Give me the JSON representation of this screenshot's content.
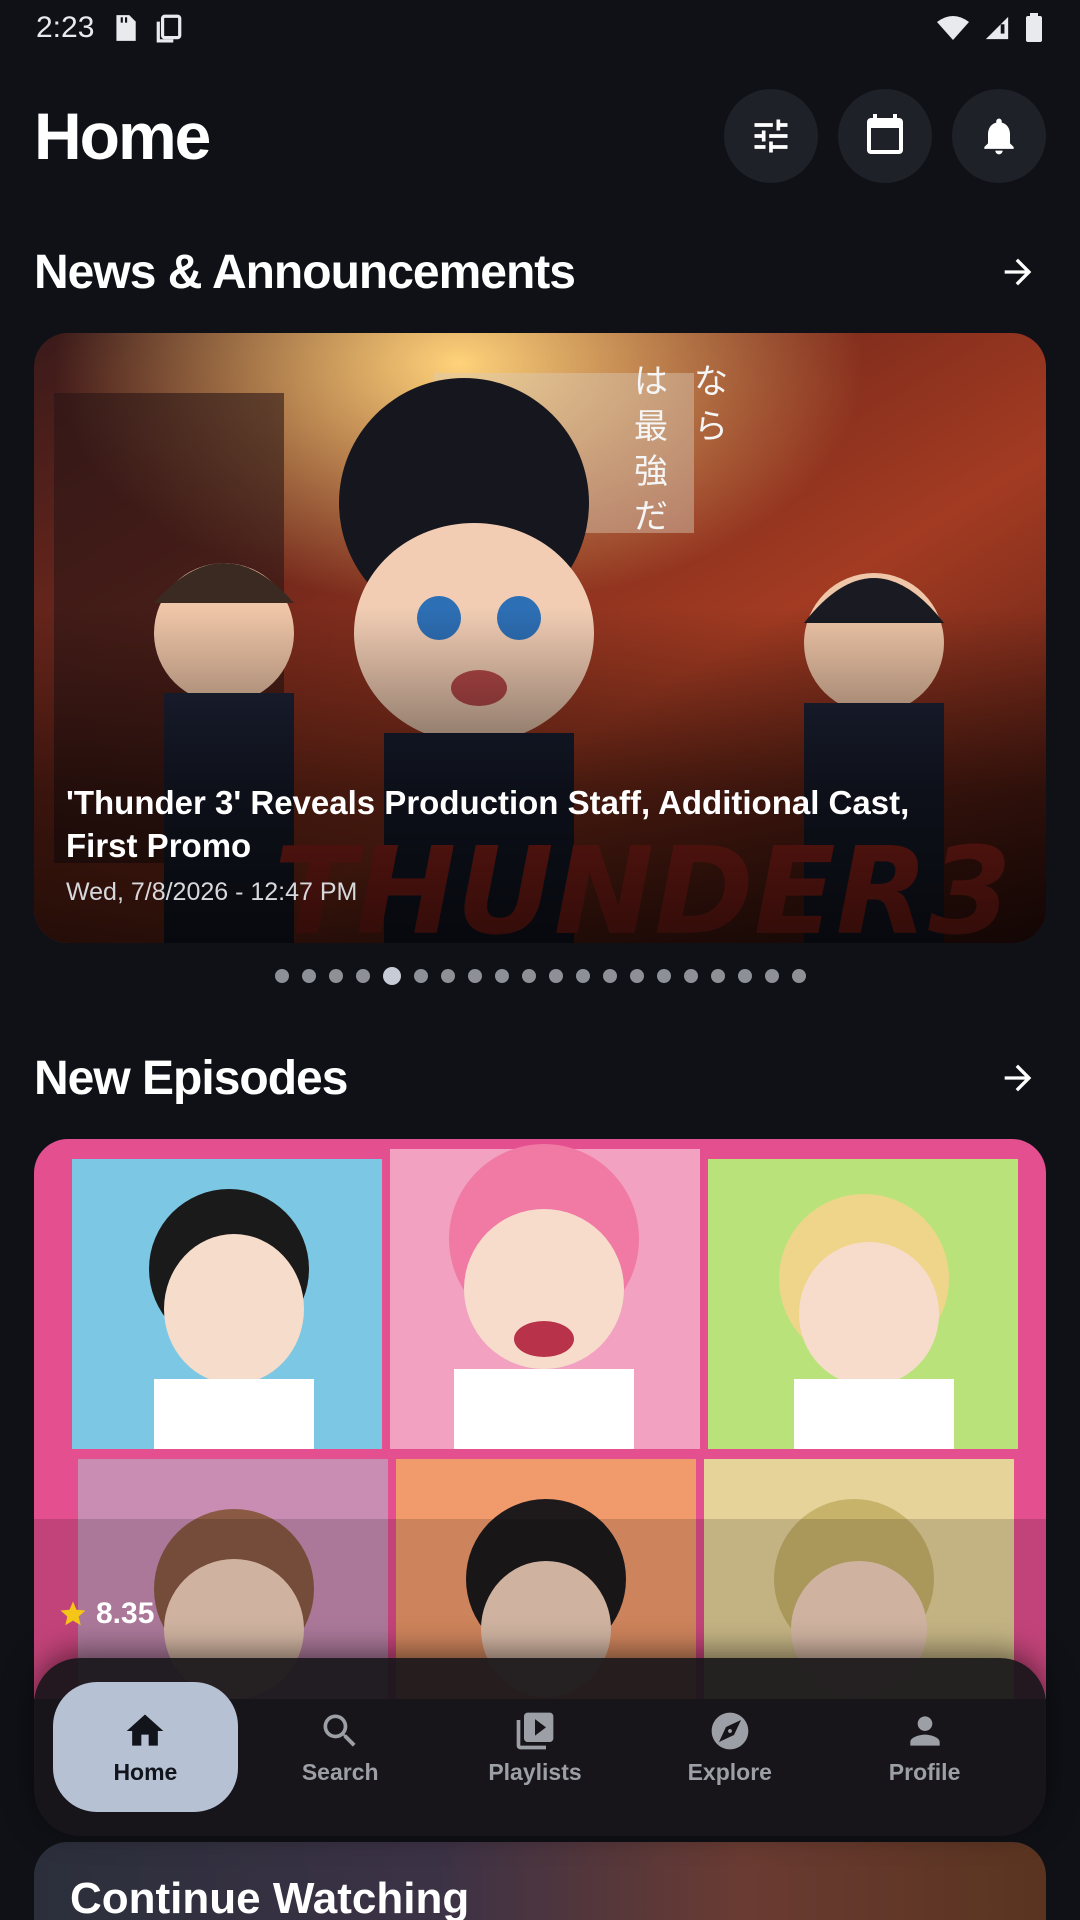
{
  "status_bar": {
    "time": "2:23",
    "icons": [
      "sd-card-icon",
      "screenshot-icon",
      "wifi-icon",
      "signal-icon",
      "battery-icon"
    ]
  },
  "header": {
    "title": "Home",
    "actions": [
      "filter-sliders-icon",
      "calendar-icon",
      "bell-icon"
    ]
  },
  "news": {
    "section_title": "News & Announcements",
    "headline": "'Thunder 3' Reveals Production Staff, Additional Cast, First Promo",
    "date": "Wed, 7/8/2026 - 12:47 PM",
    "dots_total": 20,
    "dots_active_index": 4
  },
  "episodes": {
    "section_title": "New Episodes",
    "rating": "8.35"
  },
  "continue": {
    "title": "Continue Watching"
  },
  "bottom_nav": {
    "items": [
      {
        "label": "Home",
        "icon": "home-icon",
        "active": true
      },
      {
        "label": "Search",
        "icon": "search-icon",
        "active": false
      },
      {
        "label": "Playlists",
        "icon": "playlist-icon",
        "active": false
      },
      {
        "label": "Explore",
        "icon": "compass-icon",
        "active": false
      },
      {
        "label": "Profile",
        "icon": "person-icon",
        "active": false
      }
    ]
  },
  "colors": {
    "background": "#0f1116",
    "nav_active": "#b7c1d4",
    "star": "#f5c518"
  }
}
